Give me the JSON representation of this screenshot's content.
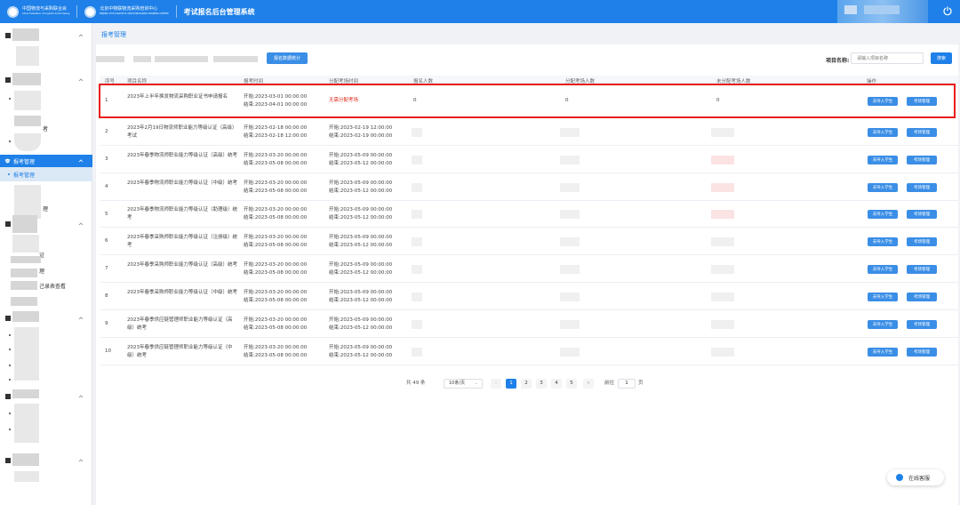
{
  "header": {
    "org1_cn": "中国物流与采购联合会",
    "org1_en": "China Federation of Logistics & Purchasing",
    "org2_cn": "北京中物联物流采购培训中心",
    "org2_en": "BEIJING CFLP LOGISTICS AND PURCHASING TRAINING CENTER",
    "system_title": "考试报名后台管理系统"
  },
  "sidebar": {
    "active_menu": "报考管理",
    "active_sub": "报考管理",
    "partial_texts": [
      "者",
      "理",
      "证",
      "理",
      "己录表查看"
    ]
  },
  "breadcrumb": "报考管理",
  "toolbar": {
    "stat_button": "报名数据统计",
    "search_label": "项目名称:",
    "search_placeholder": "请输入项目名称",
    "search_button": "搜索"
  },
  "table": {
    "columns": [
      "序号",
      "项目名称",
      "报考时间",
      "分配考场时间",
      "报名人数",
      "分配考场人数",
      "未分配考场人数",
      "操作"
    ],
    "action_import": "去导入学生",
    "action_exam": "考场管理",
    "rows": [
      {
        "no": "1",
        "name": "2023年上半年换发物流采购职业证书申请报名",
        "reg_start": "开始:2023-03-01 00:00:00",
        "reg_end": "结束:2023-04-01 00:00:00",
        "alloc": "无需分配考场",
        "alloc_end": "",
        "count": "0",
        "assigned": "0",
        "unassigned": "0"
      },
      {
        "no": "2",
        "name": "2023年2月19日物流师职业能力等级认证（高级）考试",
        "reg_start": "开始:2023-02-18 00:00:00",
        "reg_end": "结束:2023-02-18 12:00:00",
        "alloc": "开始:2023-02-19 12:00:00",
        "alloc_end": "结束:2023-02-19 00:00:00",
        "count": "",
        "assigned": "",
        "unassigned": ""
      },
      {
        "no": "3",
        "name": "2023年春季物流师职业能力等级认证（高级）统考",
        "reg_start": "开始:2023-03-20 00:00:00",
        "reg_end": "结束:2023-05-08 00:00:00",
        "alloc": "开始:2023-05-09 00:00:00",
        "alloc_end": "结束:2023-05-12 00:00:00",
        "count": "",
        "assigned": "",
        "unassigned": ""
      },
      {
        "no": "4",
        "name": "2023年春季物流师职业能力等级认证（中级）统考",
        "reg_start": "开始:2023-03-20 00:00:00",
        "reg_end": "结束:2023-05-08 00:00:00",
        "alloc": "开始:2023-05-09 00:00:00",
        "alloc_end": "结束:2023-05-12 00:00:00",
        "count": "",
        "assigned": "",
        "unassigned": ""
      },
      {
        "no": "5",
        "name": "2023年春季物流师职业能力等级认证（助理级）统考",
        "reg_start": "开始:2023-03-20 00:00:00",
        "reg_end": "结束:2023-05-08 00:00:00",
        "alloc": "开始:2023-05-09 00:00:00",
        "alloc_end": "结束:2023-05-12 00:00:00",
        "count": "",
        "assigned": "",
        "unassigned": ""
      },
      {
        "no": "6",
        "name": "2023年春季采购师职业能力等级认证（注册级）统考",
        "reg_start": "开始:2023-03-20 00:00:00",
        "reg_end": "结束:2023-05-08 00:00:00",
        "alloc": "开始:2023-05-09 00:00:00",
        "alloc_end": "结束:2023-05-12 00:00:00",
        "count": "",
        "assigned": "",
        "unassigned": ""
      },
      {
        "no": "7",
        "name": "2023年春季采购师职业能力等级认证（高级）统考",
        "reg_start": "开始:2023-03-20 00:00:00",
        "reg_end": "结束:2023-05-08 00:00:00",
        "alloc": "开始:2023-05-09 00:00:00",
        "alloc_end": "结束:2023-05-12 00:00:00",
        "count": "",
        "assigned": "",
        "unassigned": ""
      },
      {
        "no": "8",
        "name": "2023年春季采购师职业能力等级认证（中级）统考",
        "reg_start": "开始:2023-03-20 00:00:00",
        "reg_end": "结束:2023-05-08 00:00:00",
        "alloc": "开始:2023-05-09 00:00:00",
        "alloc_end": "结束:2023-05-12 00:00:00",
        "count": "",
        "assigned": "",
        "unassigned": ""
      },
      {
        "no": "9",
        "name": "2023年春季供应链管理师职业能力等级认证（高级）统考",
        "reg_start": "开始:2023-03-20 00:00:00",
        "reg_end": "结束:2023-05-08 00:00:00",
        "alloc": "开始:2023-05-09 00:00:00",
        "alloc_end": "结束:2023-05-12 00:00:00",
        "count": "",
        "assigned": "",
        "unassigned": ""
      },
      {
        "no": "10",
        "name": "2023年春季供应链管理师职业能力等级认证（中级）统考",
        "reg_start": "开始:2023-03-20 00:00:00",
        "reg_end": "结束:2023-05-08 00:00:00",
        "alloc": "开始:2023-05-09 00:00:00",
        "alloc_end": "结束:2023-05-12 00:00:00",
        "count": "",
        "assigned": "",
        "unassigned": ""
      }
    ]
  },
  "pagination": {
    "total": "共 49 条",
    "page_size": "10条/页",
    "pages": [
      "1",
      "2",
      "3",
      "4",
      "5"
    ],
    "current": "1",
    "goto_label": "前往",
    "goto_value": "1",
    "page_suffix": "页"
  },
  "service": {
    "label": "在线客服"
  },
  "colors": {
    "primary": "#1e80e8",
    "danger": "#e0281c"
  }
}
